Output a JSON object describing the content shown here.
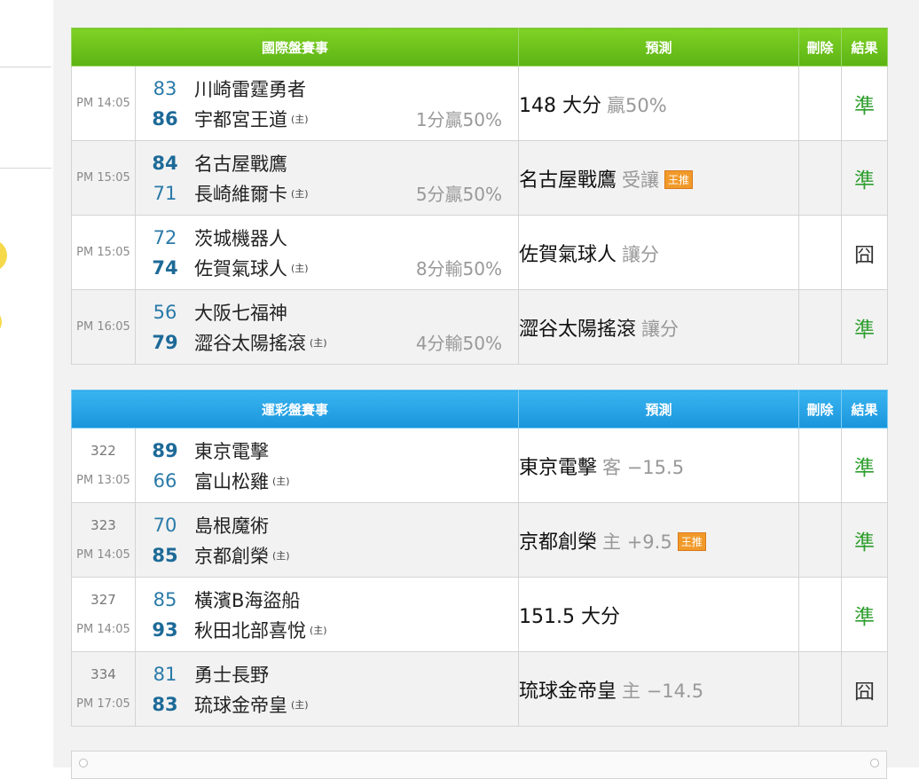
{
  "international": {
    "header": {
      "event": "國際盤賽事",
      "prediction": "預測",
      "delete": "刪除",
      "result": "結果"
    },
    "rows": [
      {
        "time": "PM 14:05",
        "away_score": "83",
        "away_team": "川崎雷霆勇者",
        "home_score": "86",
        "home_team": "宇都宮王道",
        "home_mark": "(主)",
        "spread": "1分贏50%",
        "pred_main": "148 大分",
        "pred_sub": "贏50%",
        "badge": "",
        "result": "準",
        "result_ok": true,
        "bold": "home"
      },
      {
        "time": "PM 15:05",
        "away_score": "84",
        "away_team": "名古屋戰鷹",
        "home_score": "71",
        "home_team": "長崎維爾卡",
        "home_mark": "(主)",
        "spread": "5分贏50%",
        "pred_main": "名古屋戰鷹",
        "pred_sub": "受讓",
        "badge": "王推",
        "result": "準",
        "result_ok": true,
        "bold": "away"
      },
      {
        "time": "PM 15:05",
        "away_score": "72",
        "away_team": "茨城機器人",
        "home_score": "74",
        "home_team": "佐賀氣球人",
        "home_mark": "(主)",
        "spread": "8分輸50%",
        "pred_main": "佐賀氣球人",
        "pred_sub": "讓分",
        "badge": "",
        "result": "囧",
        "result_ok": false,
        "bold": "home"
      },
      {
        "time": "PM 16:05",
        "away_score": "56",
        "away_team": "大阪七福神",
        "home_score": "79",
        "home_team": "澀谷太陽搖滾",
        "home_mark": "(主)",
        "spread": "4分輸50%",
        "pred_main": "澀谷太陽搖滾",
        "pred_sub": "讓分",
        "badge": "",
        "result": "準",
        "result_ok": true,
        "bold": "home"
      }
    ]
  },
  "lottery": {
    "header": {
      "event": "運彩盤賽事",
      "prediction": "預測",
      "delete": "刪除",
      "result": "結果"
    },
    "rows": [
      {
        "no": "322",
        "time": "PM 13:05",
        "away_score": "89",
        "away_team": "東京電擊",
        "home_score": "66",
        "home_team": "富山松雞",
        "home_mark": "(主)",
        "pred_main": "東京電擊",
        "pred_sub": "客 −15.5",
        "badge": "",
        "result": "準",
        "result_ok": true,
        "bold": "away"
      },
      {
        "no": "323",
        "time": "PM 14:05",
        "away_score": "70",
        "away_team": "島根魔術",
        "home_score": "85",
        "home_team": "京都創榮",
        "home_mark": "(主)",
        "pred_main": "京都創榮",
        "pred_sub": "主 +9.5",
        "badge": "王推",
        "result": "準",
        "result_ok": true,
        "bold": "home"
      },
      {
        "no": "327",
        "time": "PM 14:05",
        "away_score": "85",
        "away_team": "橫濱B海盜船",
        "home_score": "93",
        "home_team": "秋田北部喜悅",
        "home_mark": "(主)",
        "pred_main": "151.5 大分",
        "pred_sub": "",
        "badge": "",
        "result": "準",
        "result_ok": true,
        "bold": "home"
      },
      {
        "no": "334",
        "time": "PM 17:05",
        "away_score": "81",
        "away_team": "勇士長野",
        "home_score": "83",
        "home_team": "琉球金帝皇",
        "home_mark": "(主)",
        "pred_main": "琉球金帝皇",
        "pred_sub": "主 −14.5",
        "badge": "",
        "result": "囧",
        "result_ok": false,
        "bold": "home"
      }
    ]
  },
  "colors": {
    "green_header": "#6cc31c",
    "blue_header": "#26a4e6",
    "ok": "#2f9e2f",
    "score": "#2a7aa8",
    "badge": "#f19a2a"
  }
}
